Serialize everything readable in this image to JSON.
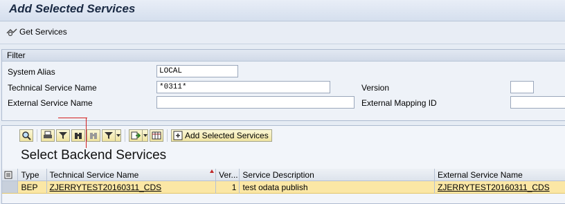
{
  "window": {
    "title": "Add Selected Services"
  },
  "appbar": {
    "get_services_label": "Get Services"
  },
  "filter": {
    "header": "Filter",
    "system_alias_label": "System Alias",
    "system_alias_value": "LOCAL",
    "technical_service_name_label": "Technical Service Name",
    "technical_service_name_value": "*0311*",
    "version_label": "Version",
    "version_value": "",
    "external_service_name_label": "External Service Name",
    "external_service_name_value": "",
    "external_mapping_id_label": "External Mapping ID",
    "external_mapping_id_value": ""
  },
  "toolbar": {
    "icons": [
      "details-icon",
      "print-icon",
      "filter-icon",
      "find-icon",
      "find-next-icon",
      "set-filter-icon",
      "export-icon",
      "layout-icon"
    ],
    "add_selected_label": "Add Selected Services"
  },
  "grid": {
    "title": "Select Backend Services",
    "columns": [
      "Type",
      "Technical Service Name",
      "Ver...",
      "Service Description",
      "External Service Name"
    ],
    "rows": [
      {
        "type": "BEP",
        "technical_service_name": "ZJERRYTEST20160311_CDS",
        "version": "1",
        "service_description": "test odata publish",
        "external_service_name": "ZJERRYTEST20160311_CDS"
      }
    ]
  },
  "colors": {
    "selected_row": "#fbe7a5",
    "title_text": "#1a2a44",
    "toolbar_button": "#efe3a0"
  }
}
